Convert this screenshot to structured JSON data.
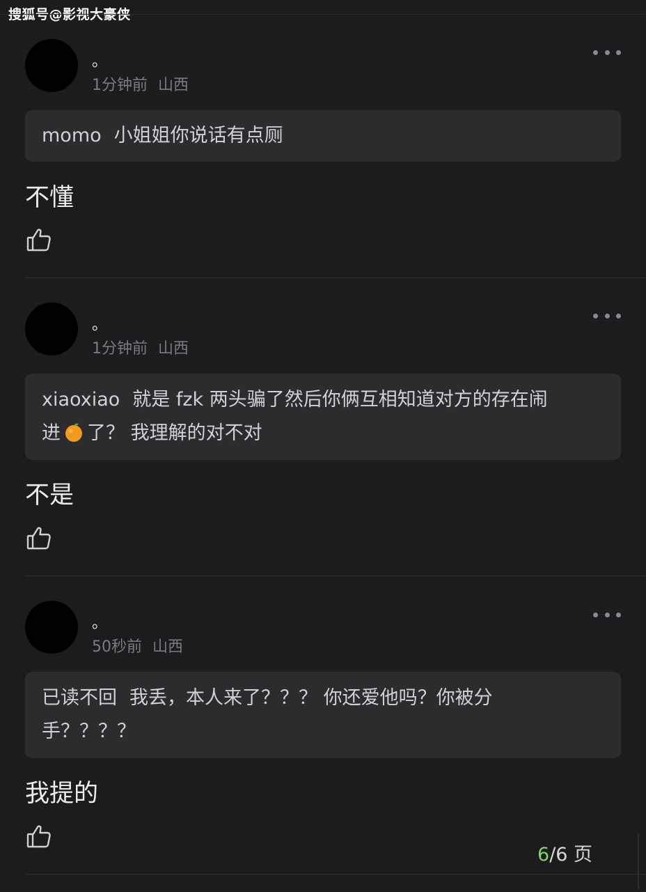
{
  "watermark": "搜狐号@影视大豪侠",
  "comments": [
    {
      "username": "。",
      "time": "1分钟前",
      "location": "山西",
      "quote_user": "momo",
      "quote_text": "小姐姐你说话有点厕",
      "reply": "不懂"
    },
    {
      "username": "。",
      "time": "1分钟前",
      "location": "山西",
      "quote_user": "xiaoxiao",
      "quote_text_1": "就是 fzk 两头骗了然后你俩互相知道对方的存在闹",
      "quote_text_2_a": "进",
      "quote_text_2_b": "了？ 我理解的对不对",
      "quote_emoji": "orange-emoji",
      "reply": "不是"
    },
    {
      "username": "。",
      "time": "50秒前",
      "location": "山西",
      "quote_user": "已读不回",
      "quote_text_1": "我丢，本人来了？？？ 你还爱他吗？你被分",
      "quote_text_2": "手？？？？",
      "reply": "我提的"
    }
  ],
  "pager": {
    "current": "6",
    "total": "/6 页"
  },
  "colors": {
    "background": "#1c1c1e",
    "quote_background": "#2c2c2f",
    "pager_accent": "#7fd46a"
  }
}
